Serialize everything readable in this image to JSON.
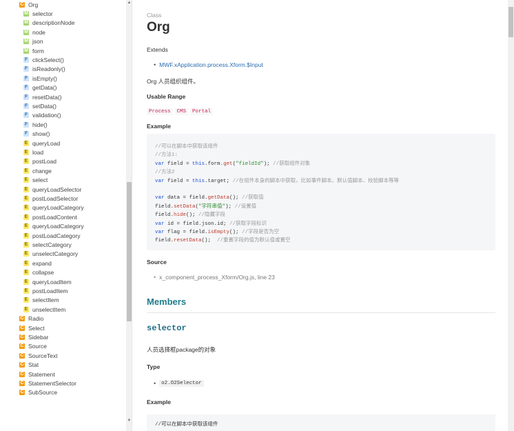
{
  "sidebar": {
    "items": [
      {
        "badge": "C",
        "label": "Org",
        "level": 0
      },
      {
        "badge": "M",
        "label": "selector",
        "level": 1
      },
      {
        "badge": "M",
        "label": "descriptionNode",
        "level": 1
      },
      {
        "badge": "M",
        "label": "node",
        "level": 1
      },
      {
        "badge": "M",
        "label": "json",
        "level": 1
      },
      {
        "badge": "M",
        "label": "form",
        "level": 1
      },
      {
        "badge": "F",
        "label": "clickSelect()",
        "level": 1
      },
      {
        "badge": "F",
        "label": "isReadonly()",
        "level": 1
      },
      {
        "badge": "F",
        "label": "isEmpty()",
        "level": 1
      },
      {
        "badge": "F",
        "label": "getData()",
        "level": 1
      },
      {
        "badge": "F",
        "label": "resetData()",
        "level": 1
      },
      {
        "badge": "F",
        "label": "setData()",
        "level": 1
      },
      {
        "badge": "F",
        "label": "validation()",
        "level": 1
      },
      {
        "badge": "F",
        "label": "hide()",
        "level": 1
      },
      {
        "badge": "F",
        "label": "show()",
        "level": 1
      },
      {
        "badge": "E",
        "label": "queryLoad",
        "level": 1
      },
      {
        "badge": "E",
        "label": "load",
        "level": 1
      },
      {
        "badge": "E",
        "label": "postLoad",
        "level": 1
      },
      {
        "badge": "E",
        "label": "change",
        "level": 1
      },
      {
        "badge": "E",
        "label": "select",
        "level": 1
      },
      {
        "badge": "E",
        "label": "queryLoadSelector",
        "level": 1
      },
      {
        "badge": "E",
        "label": "postLoadSelector",
        "level": 1
      },
      {
        "badge": "E",
        "label": "queryLoadCategory",
        "level": 1
      },
      {
        "badge": "E",
        "label": "postLoadContent",
        "level": 1
      },
      {
        "badge": "E",
        "label": "queryLoadCategory",
        "level": 1
      },
      {
        "badge": "E",
        "label": "postLoadCategory",
        "level": 1
      },
      {
        "badge": "E",
        "label": "selectCategory",
        "level": 1
      },
      {
        "badge": "E",
        "label": "unselectCategory",
        "level": 1
      },
      {
        "badge": "E",
        "label": "expand",
        "level": 1
      },
      {
        "badge": "E",
        "label": "collapse",
        "level": 1
      },
      {
        "badge": "E",
        "label": "queryLoadItem",
        "level": 1
      },
      {
        "badge": "E",
        "label": "postLoadItem",
        "level": 1
      },
      {
        "badge": "E",
        "label": "selectItem",
        "level": 1
      },
      {
        "badge": "E",
        "label": "unselectItem",
        "level": 1
      },
      {
        "badge": "C",
        "label": "Radio",
        "level": 0
      },
      {
        "badge": "C",
        "label": "Select",
        "level": 0
      },
      {
        "badge": "C",
        "label": "Sidebar",
        "level": 0
      },
      {
        "badge": "C",
        "label": "Source",
        "level": 0
      },
      {
        "badge": "C",
        "label": "SourceText",
        "level": 0
      },
      {
        "badge": "C",
        "label": "Stat",
        "level": 0
      },
      {
        "badge": "C",
        "label": "Statement",
        "level": 0
      },
      {
        "badge": "C",
        "label": "StatementSelector",
        "level": 0
      },
      {
        "badge": "C",
        "label": "SubSource",
        "level": 0
      }
    ]
  },
  "doc": {
    "kicker": "Class",
    "title": "Org",
    "extends_label": "Extends",
    "extends_link": "MWF.xApplication.process.Xform.$Input",
    "description": "Org 人员组织组件。",
    "usable_range_label": "Usable Range",
    "usable_range_tags": [
      "Process",
      "CMS",
      "Portal"
    ],
    "example_label": "Example",
    "code_lines": [
      [
        {
          "t": "//可以在脚本中获取该组件",
          "c": "com"
        }
      ],
      [
        {
          "t": "//方法1:",
          "c": "com"
        }
      ],
      [
        {
          "t": "var",
          "c": "kw"
        },
        {
          "t": " field = ",
          "c": ""
        },
        {
          "t": "this",
          "c": "this"
        },
        {
          "t": ".form.",
          "c": ""
        },
        {
          "t": "get",
          "c": "fn"
        },
        {
          "t": "(",
          "c": ""
        },
        {
          "t": "\"fieldId\"",
          "c": "str"
        },
        {
          "t": "); ",
          "c": ""
        },
        {
          "t": "//获取组件对象",
          "c": "com"
        }
      ],
      [
        {
          "t": "//方法2",
          "c": "com"
        }
      ],
      [
        {
          "t": "var",
          "c": "kw"
        },
        {
          "t": " field = ",
          "c": ""
        },
        {
          "t": "this",
          "c": "this"
        },
        {
          "t": ".target; ",
          "c": ""
        },
        {
          "t": "//在组件本身的脚本中获取，比如事件脚本、默认值脚本、校验脚本等等",
          "c": "com"
        }
      ],
      [
        {
          "t": "",
          "c": ""
        }
      ],
      [
        {
          "t": "var",
          "c": "kw"
        },
        {
          "t": " data = field.",
          "c": ""
        },
        {
          "t": "getData",
          "c": "fn"
        },
        {
          "t": "(); ",
          "c": ""
        },
        {
          "t": "//获取值",
          "c": "com"
        }
      ],
      [
        {
          "t": "field.",
          "c": ""
        },
        {
          "t": "setData",
          "c": "fn"
        },
        {
          "t": "(",
          "c": ""
        },
        {
          "t": "\"字符串值\"",
          "c": "str"
        },
        {
          "t": "); ",
          "c": ""
        },
        {
          "t": "//设置值",
          "c": "com"
        }
      ],
      [
        {
          "t": "field.",
          "c": ""
        },
        {
          "t": "hide",
          "c": "fn"
        },
        {
          "t": "(); ",
          "c": ""
        },
        {
          "t": "//隐藏字段",
          "c": "com"
        }
      ],
      [
        {
          "t": "var",
          "c": "kw"
        },
        {
          "t": " id = field.json.id; ",
          "c": ""
        },
        {
          "t": "//获取字段标识",
          "c": "com"
        }
      ],
      [
        {
          "t": "var",
          "c": "kw"
        },
        {
          "t": " flag = field.",
          "c": ""
        },
        {
          "t": "isEmpty",
          "c": "fn"
        },
        {
          "t": "(); ",
          "c": ""
        },
        {
          "t": "//字段是否为空",
          "c": "com"
        }
      ],
      [
        {
          "t": "field.",
          "c": ""
        },
        {
          "t": "resetData",
          "c": "fn"
        },
        {
          "t": "();  ",
          "c": ""
        },
        {
          "t": "//重置字段的值为默认值或置空",
          "c": "com"
        }
      ]
    ],
    "source_label": "Source",
    "source_text": "x_component_process_Xform/Org.js, line 23",
    "members_label": "Members",
    "member": {
      "name": "selector",
      "description": "人员选择框package的对象",
      "type_label": "Type",
      "type_value": "o2.O2Selector",
      "example_label": "Example",
      "code_first_line": "//可以在脚本中获取该组件"
    }
  },
  "colors": {
    "class_badge": "#f39c12",
    "member_badge": "#a5d56f",
    "function_badge": "#cfe3f7",
    "event_badge": "#f7e86a",
    "members_heading": "#1e7b8a",
    "link": "#2b6cb0"
  }
}
